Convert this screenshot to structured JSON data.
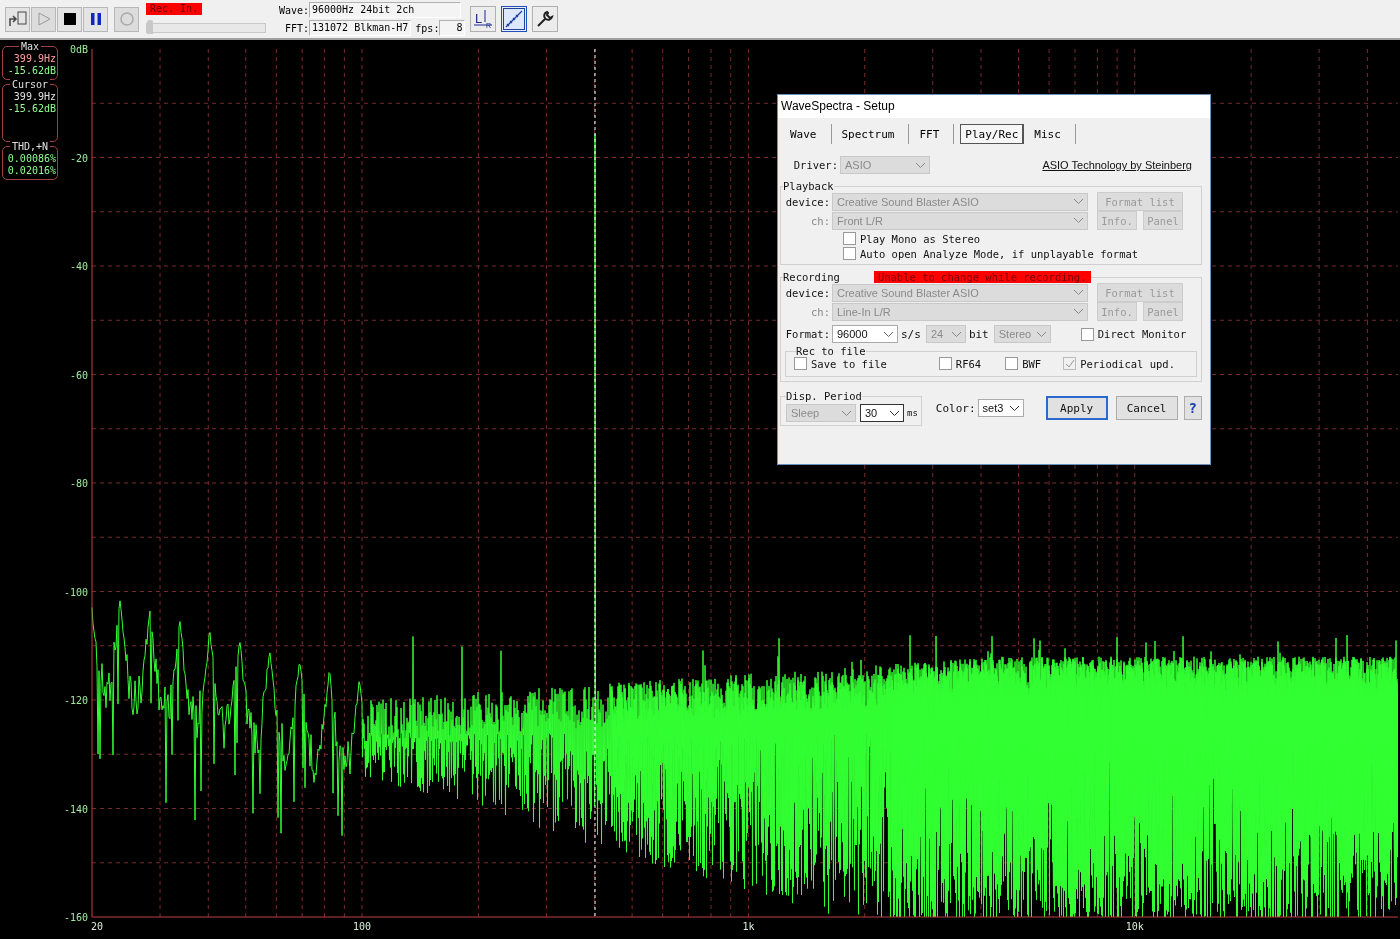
{
  "toolbar": {
    "buttons": [
      {
        "kind": "export",
        "disabled": false
      },
      {
        "kind": "play",
        "disabled": true
      },
      {
        "kind": "stop",
        "disabled": false
      },
      {
        "kind": "pause",
        "disabled": false
      },
      {
        "kind": "record",
        "disabled": true
      }
    ],
    "rec_in_label": "Rec. In.",
    "input_level": {
      "level": 0
    },
    "wave": {
      "label": "Wave:",
      "value": "96000Hz 24bit 2ch"
    },
    "fft": {
      "label": "FFT:",
      "value": "131072 Blkman-H7"
    },
    "fps": {
      "label": "fps:",
      "value": "8"
    },
    "tools": [
      {
        "kind": "channels",
        "selected": false,
        "letters": [
          "L",
          "R"
        ]
      },
      {
        "kind": "scale",
        "selected": true
      },
      {
        "kind": "settings",
        "selected": false
      }
    ]
  },
  "readouts": [
    {
      "title": "Max",
      "lines": [
        {
          "text": "399.9Hz",
          "color": "#ffa0a0"
        },
        {
          "text": "-15.62dB",
          "color": "#90ff90"
        }
      ]
    },
    {
      "title": "Cursor",
      "lines": [
        {
          "text": "399.9Hz",
          "color": "#e0e0e0"
        },
        {
          "text": "-15.62dB",
          "color": "#90ff90"
        }
      ]
    },
    {
      "title": "THD,+N",
      "lines": [
        {
          "text": "0.00086%",
          "color": "#90ff90"
        },
        {
          "text": "0.02016%",
          "color": "#90ff90"
        }
      ]
    }
  ],
  "spectrum": {
    "x_axis_labels": [
      "20",
      "100",
      "1k",
      "10k"
    ],
    "y_axis_labels": [
      "0dB",
      "-20",
      "-40",
      "-60",
      "-80",
      "-100",
      "-120",
      "-140",
      "-160"
    ]
  },
  "dialog": {
    "title": "WaveSpectra - Setup",
    "tabs": [
      {
        "label": "Wave",
        "selected": false
      },
      {
        "label": "Spectrum",
        "selected": false
      },
      {
        "label": "FFT",
        "selected": false
      },
      {
        "label": "Play/Rec",
        "selected": true
      },
      {
        "label": "Misc",
        "selected": false
      }
    ],
    "driver": {
      "label": "Driver:",
      "value": "ASIO",
      "disabled": true
    },
    "link": "ASIO Technology by Steinberg",
    "playback": {
      "legend": "Playback",
      "device_label": "device:",
      "device": {
        "value": "Creative Sound Blaster ASIO",
        "disabled": true
      },
      "ch_label": "ch:",
      "ch": {
        "value": "Front L/R",
        "disabled": true
      },
      "buttons": [
        {
          "label": "Format list",
          "disabled": true
        },
        {
          "label": "Info.",
          "disabled": true
        },
        {
          "label": "Panel",
          "disabled": true
        }
      ],
      "options": [
        {
          "label": "Play Mono as Stereo",
          "checked": false
        },
        {
          "label": "Auto open Analyze Mode, if unplayable format",
          "checked": false
        }
      ]
    },
    "recording": {
      "legend": "Recording",
      "warning": "Unable to change while recording.",
      "device_label": "device:",
      "device": {
        "value": "Creative Sound Blaster ASIO",
        "disabled": true
      },
      "ch_label": "ch:",
      "ch": {
        "value": "Line-In L/R",
        "disabled": true
      },
      "buttons": [
        {
          "label": "Format list",
          "disabled": true
        },
        {
          "label": "Info.",
          "disabled": true
        },
        {
          "label": "Panel",
          "disabled": true
        }
      ],
      "format_label": "Format:",
      "format": {
        "value": "96000",
        "disabled": false
      },
      "rate_unit": "s/s",
      "bits": {
        "value": "24",
        "disabled": true
      },
      "bit_unit": "bit",
      "channels": {
        "value": "Stereo",
        "disabled": true
      },
      "direct_monitor": {
        "label": "Direct Monitor",
        "checked": false
      },
      "rec_to_file": {
        "legend": "Rec to file",
        "options": [
          {
            "label": "Save to file",
            "checked": false,
            "disabled": false
          },
          {
            "label": "RF64",
            "checked": false,
            "disabled": false
          },
          {
            "label": "BWF",
            "checked": false,
            "disabled": false
          },
          {
            "label": "Periodical upd.",
            "checked": true,
            "disabled": true
          }
        ]
      }
    },
    "disp_period": {
      "legend": "Disp. Period",
      "mode": {
        "value": "Sleep",
        "disabled": true
      },
      "interval": {
        "value": "30",
        "disabled": false
      },
      "unit": "ms"
    },
    "color": {
      "label": "Color:",
      "value": "set3"
    },
    "buttons": [
      {
        "kind": "apply",
        "label": "Apply"
      },
      {
        "kind": "cancel",
        "label": "Cancel"
      },
      {
        "kind": "help",
        "label": "?"
      }
    ]
  }
}
